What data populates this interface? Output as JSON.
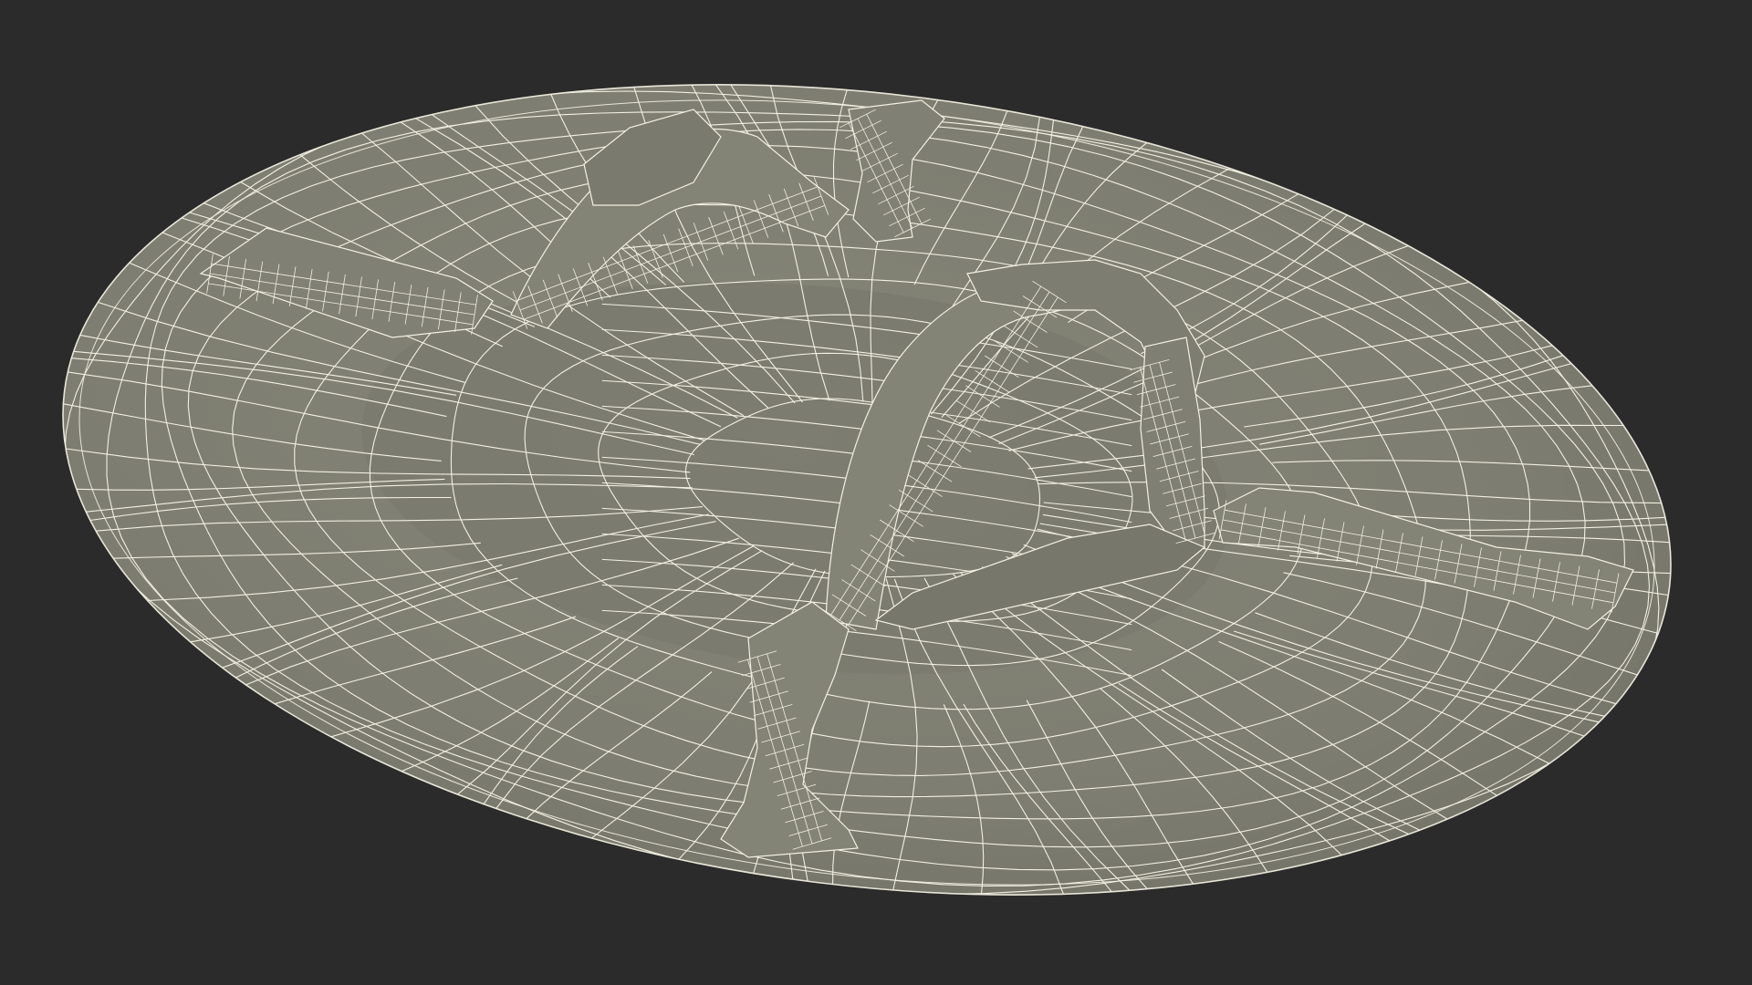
{
  "scene": {
    "object": "shield-with-straps-wireframe",
    "background_color": "#2b2b2b",
    "surface_color": "#7f7f72",
    "surface_light_color": "#8a8a7c",
    "surface_shadow_color": "#6a6a5f",
    "wire_color": "#f2f0e2",
    "parts": [
      "shield-disc",
      "upper-strap",
      "lower-arm-loop",
      "right-strap",
      "bottom-strap"
    ]
  }
}
